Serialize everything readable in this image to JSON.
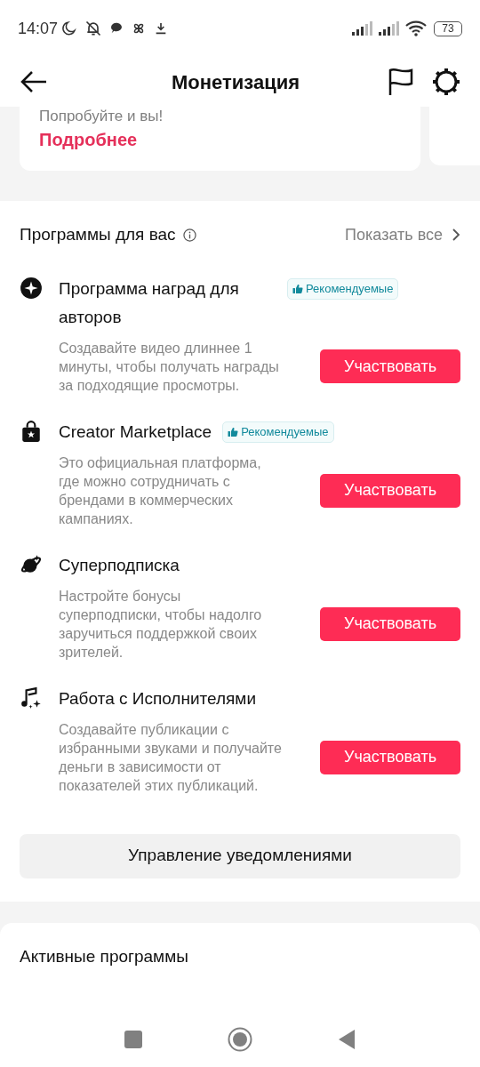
{
  "status_bar": {
    "time": "14:07",
    "battery": "73"
  },
  "header": {
    "title": "Монетизация"
  },
  "promo_card": {
    "text": "Попробуйте и вы!",
    "link": "Подробнее"
  },
  "programs_section": {
    "title": "Программы для вас",
    "show_all": "Показать все",
    "items": [
      {
        "kind": "sparkle",
        "title": "Программа наград для авторов",
        "badge": "Рекомендуемые",
        "description": "Создавайте видео длиннее 1 минуты, чтобы получать награды за подходящие просмотры.",
        "button": "Участвовать"
      },
      {
        "kind": "bag",
        "title": "Creator Marketplace",
        "badge": "Рекомендуемые",
        "description": "Это официальная платформа, где можно сотрудничать с брендами в коммерческих кампаниях.",
        "button": "Участвовать"
      },
      {
        "kind": "planet",
        "title": "Суперподписка",
        "description": "Настройте бонусы суперподписки, чтобы надолго заручиться поддержкой своих зрителей.",
        "button": "Участвовать"
      },
      {
        "kind": "music",
        "title": "Работа с Исполнителями",
        "description": "Создавайте публикации с избранными звуками и получайте деньги в зависимости от показателей этих публикаций.",
        "button": "Участвовать"
      }
    ],
    "manage_button": "Управление уведомлениями"
  },
  "active_section": {
    "title": "Активные программы"
  }
}
